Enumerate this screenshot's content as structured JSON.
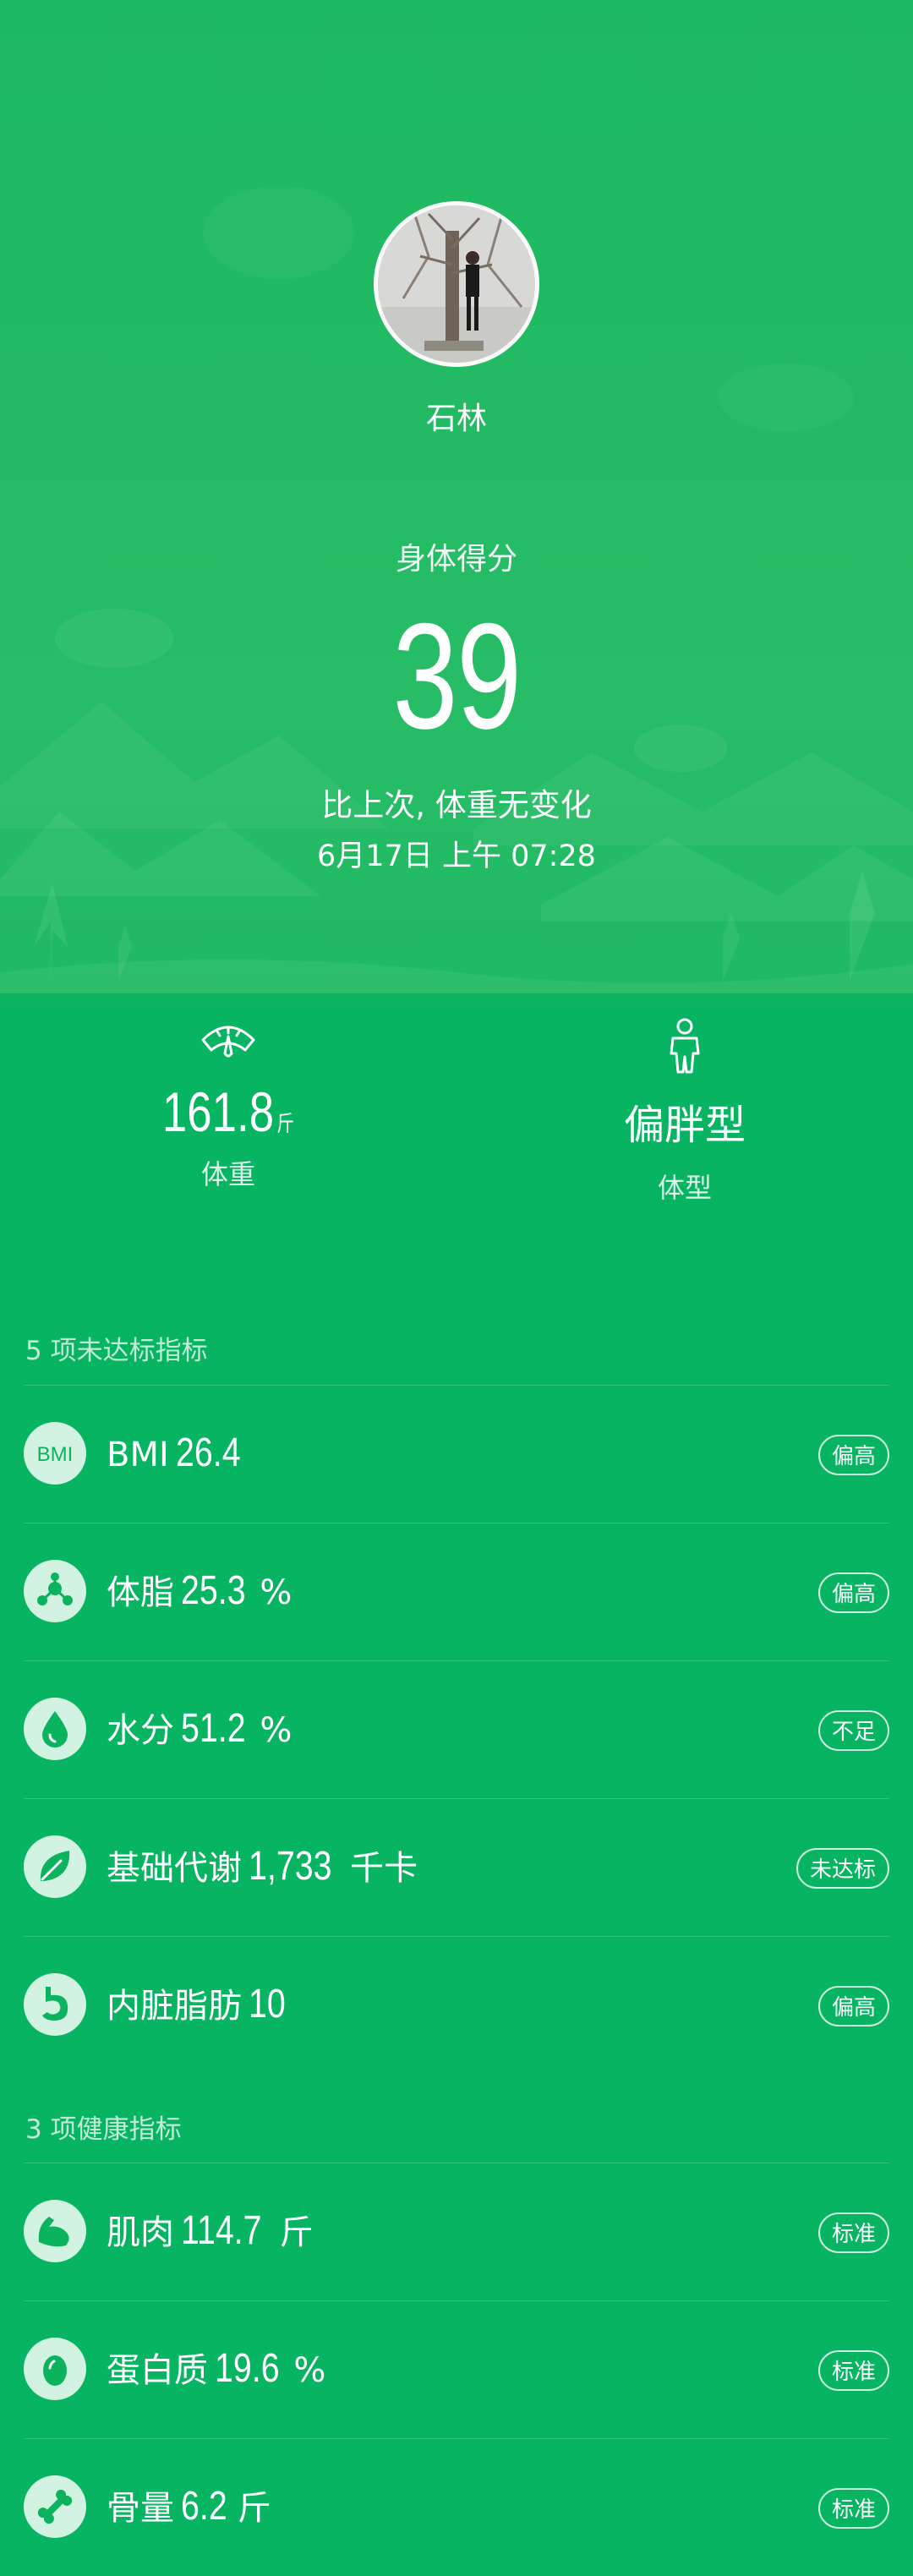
{
  "profile": {
    "name": "石林",
    "avatar_alt": "avatar-photo"
  },
  "score": {
    "label": "身体得分",
    "value": "39",
    "compare": "比上次, 体重无变化",
    "time": "6月17日 上午 07:28"
  },
  "summary": {
    "weight": {
      "value": "161.8",
      "unit": "斤",
      "label": "体重",
      "icon": "scale-icon"
    },
    "body_type": {
      "value": "偏胖型",
      "label": "体型",
      "icon": "body-figure-icon"
    }
  },
  "unmet": {
    "title": "5 项未达标指标",
    "items": [
      {
        "name": "BMI",
        "value": "26.4",
        "unit": "",
        "badge": "偏高",
        "icon": "bmi-icon"
      },
      {
        "name": "体脂",
        "value": "25.3",
        "unit": "%",
        "badge": "偏高",
        "icon": "body-fat-icon"
      },
      {
        "name": "水分",
        "value": "51.2",
        "unit": "%",
        "badge": "不足",
        "icon": "water-drop-icon"
      },
      {
        "name": "基础代谢",
        "value": "1,733",
        "unit": "千卡",
        "badge": "未达标",
        "icon": "leaf-icon"
      },
      {
        "name": "内脏脂肪",
        "value": "10",
        "unit": "",
        "badge": "偏高",
        "icon": "stomach-icon"
      }
    ]
  },
  "healthy": {
    "title": "3 项健康指标",
    "items": [
      {
        "name": "肌肉",
        "value": "114.7",
        "unit": "斤",
        "badge": "标准",
        "icon": "muscle-icon"
      },
      {
        "name": "蛋白质",
        "value": "19.6",
        "unit": "%",
        "badge": "标准",
        "icon": "egg-icon"
      },
      {
        "name": "骨量",
        "value": "6.2",
        "unit": "斤",
        "badge": "标准",
        "icon": "bone-icon"
      }
    ]
  },
  "colors": {
    "background": "#07b462",
    "header": "#22bb63",
    "icon_fill": "#0bb35e"
  }
}
